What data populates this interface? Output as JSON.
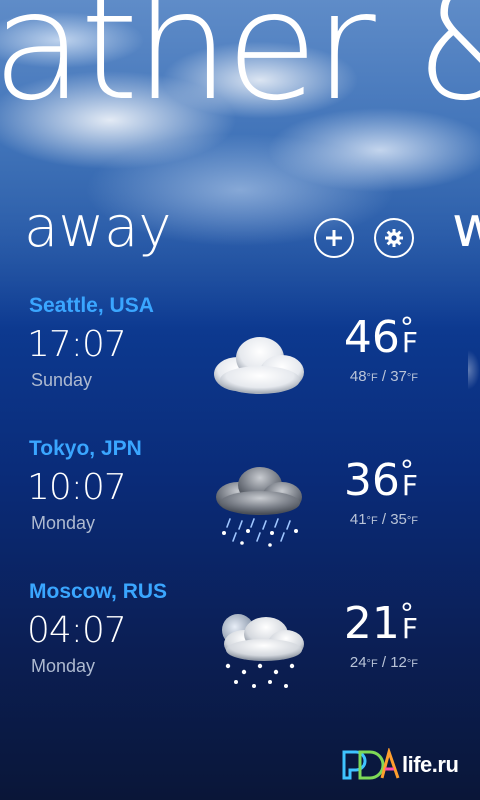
{
  "app_title": "ather &",
  "pivot": {
    "current": "away",
    "next_peek": "w"
  },
  "toolbar": {
    "add_icon": "plus-icon",
    "settings_icon": "gear-icon"
  },
  "cities": [
    {
      "name": "Seattle, USA",
      "time": "17:07",
      "day": "Sunday",
      "condition_icon": "cloudy-icon",
      "temp": "46",
      "unit": "F",
      "high": "48",
      "low": "37"
    },
    {
      "name": "Tokyo, JPN",
      "time": "10:07",
      "day": "Monday",
      "condition_icon": "snow-rain-icon",
      "temp": "36",
      "unit": "F",
      "high": "41",
      "low": "35"
    },
    {
      "name": "Moscow, RUS",
      "time": "04:07",
      "day": "Monday",
      "condition_icon": "night-snow-icon",
      "temp": "21",
      "unit": "F",
      "high": "24",
      "low": "12"
    }
  ],
  "watermark": {
    "logo_text": "PDA",
    "text": "life.ru"
  },
  "colors": {
    "city_name": "#3aa6ff",
    "sub_text": "#aebad0"
  }
}
